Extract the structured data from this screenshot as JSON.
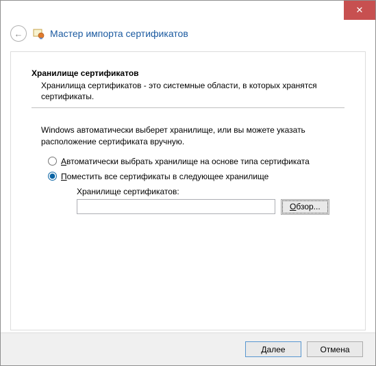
{
  "window": {
    "close_glyph": "✕"
  },
  "header": {
    "back_glyph": "←",
    "title": "Мастер импорта сертификатов"
  },
  "section": {
    "heading": "Хранилище сертификатов",
    "description": "Хранилища сертификатов - это системные области, в которых хранятся сертификаты."
  },
  "body": {
    "intro": "Windows автоматически выберет хранилище, или вы можете указать расположение сертификата вручную."
  },
  "options": {
    "auto_prefix": "А",
    "auto_rest": "втоматически выбрать хранилище на основе типа сертификата",
    "manual_prefix": "П",
    "manual_rest": "оместить все сертификаты в следующее хранилище",
    "selected": "manual"
  },
  "store": {
    "label": "Хранилище сертификатов:",
    "value": "",
    "browse_prefix": "О",
    "browse_rest": "бзор..."
  },
  "footer": {
    "next_prefix": "Д",
    "next_rest": "алее",
    "cancel": "Отмена"
  }
}
